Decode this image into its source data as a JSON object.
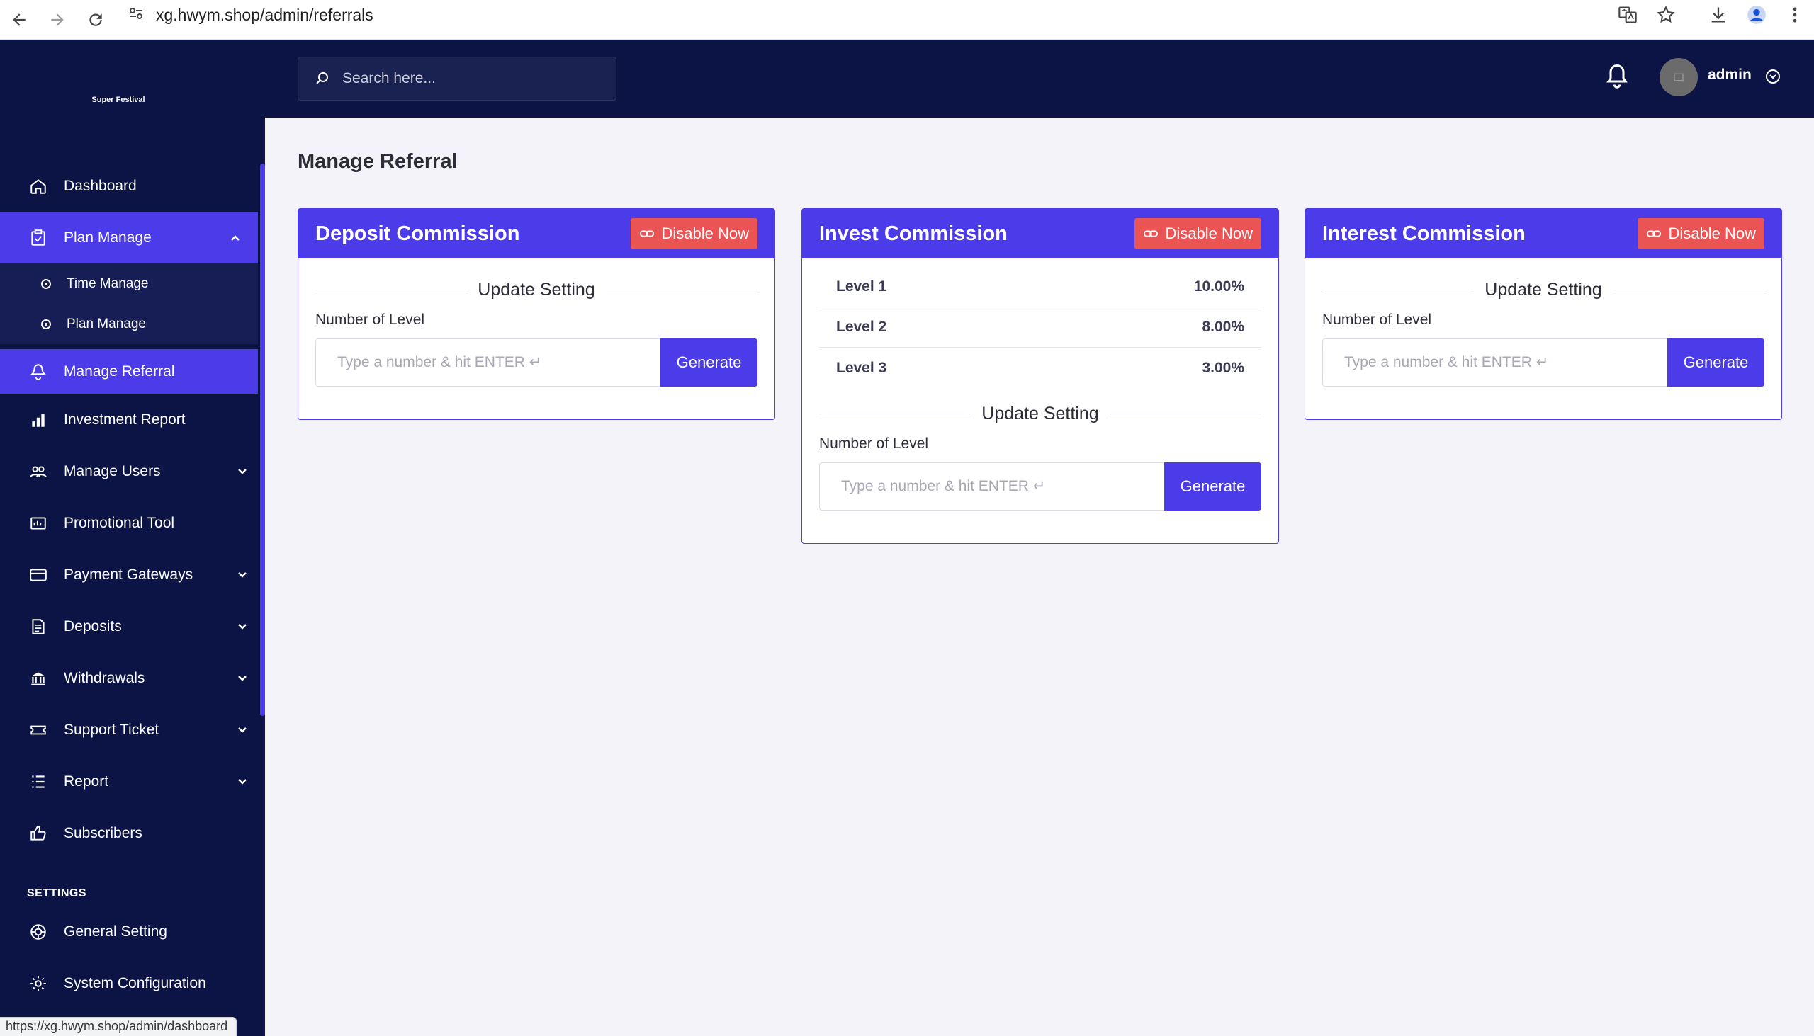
{
  "browser": {
    "url": "xg.hwym.shop/admin/referrals",
    "status_link": "https://xg.hwym.shop/admin/dashboard"
  },
  "sidebar": {
    "logo_text": "Super Festival",
    "items": [
      {
        "label": "Dashboard",
        "icon": "home-icon"
      },
      {
        "label": "Plan Manage",
        "icon": "clipboard-icon"
      },
      {
        "label": "Manage Referral",
        "icon": "referral-icon"
      },
      {
        "label": "Investment Report",
        "icon": "bar-chart-icon"
      },
      {
        "label": "Manage Users",
        "icon": "users-icon"
      },
      {
        "label": "Promotional Tool",
        "icon": "promo-icon"
      },
      {
        "label": "Payment Gateways",
        "icon": "credit-card-icon"
      },
      {
        "label": "Deposits",
        "icon": "deposit-icon"
      },
      {
        "label": "Withdrawals",
        "icon": "bank-icon"
      },
      {
        "label": "Support Ticket",
        "icon": "ticket-icon"
      },
      {
        "label": "Report",
        "icon": "list-icon"
      },
      {
        "label": "Subscribers",
        "icon": "thumbs-up-icon"
      }
    ],
    "submenu": [
      {
        "label": "Time Manage"
      },
      {
        "label": "Plan Manage"
      }
    ],
    "settings_label": "SETTINGS",
    "settings_items": [
      {
        "label": "General Setting"
      },
      {
        "label": "System Configuration"
      }
    ]
  },
  "header": {
    "search_placeholder": "Search here...",
    "user_name": "admin"
  },
  "main": {
    "page_title": "Manage Referral",
    "cards": [
      {
        "title": "Deposit Commission",
        "disable_label": "Disable Now",
        "update_title": "Update Setting",
        "field_label": "Number of Level",
        "input_placeholder": "Type a number & hit ENTER ↵",
        "generate_label": "Generate"
      },
      {
        "title": "Invest Commission",
        "disable_label": "Disable Now",
        "levels": [
          {
            "label": "Level 1",
            "value": "10.00%"
          },
          {
            "label": "Level 2",
            "value": "8.00%"
          },
          {
            "label": "Level 3",
            "value": "3.00%"
          }
        ],
        "update_title": "Update Setting",
        "field_label": "Number of Level",
        "input_placeholder": "Type a number & hit ENTER ↵",
        "generate_label": "Generate"
      },
      {
        "title": "Interest Commission",
        "disable_label": "Disable Now",
        "update_title": "Update Setting",
        "field_label": "Number of Level",
        "input_placeholder": "Type a number & hit ENTER ↵",
        "generate_label": "Generate"
      }
    ]
  },
  "colors": {
    "sidebar_bg": "#0c1446",
    "accent": "#4b3be8",
    "danger": "#ea5455",
    "page_bg": "#f3f3f9"
  }
}
